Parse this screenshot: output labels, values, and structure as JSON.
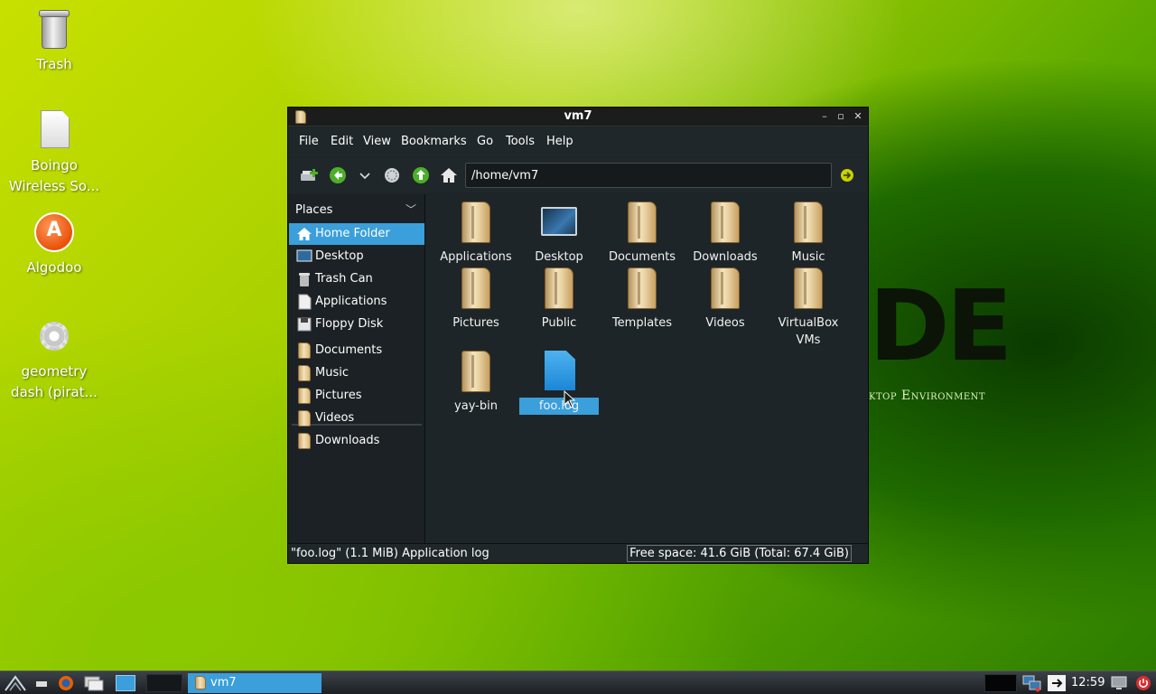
{
  "desktop": {
    "icons": [
      {
        "label": "Trash",
        "icon": "trash-icon"
      },
      {
        "label": "Boingo\nWireless So...",
        "icon": "document-icon"
      },
      {
        "label": "Algodoo",
        "icon": "algodoo-icon"
      },
      {
        "label": "geometry\ndash (pirat...",
        "icon": "gear-icon"
      }
    ],
    "wallpaper_logo": "DE",
    "wallpaper_subtitle": "ktop Environment"
  },
  "window": {
    "title": "vm7",
    "menu": [
      "File",
      "Edit",
      "View",
      "Bookmarks",
      "Go",
      "Tools",
      "Help"
    ],
    "location": "/home/vm7",
    "sidebar": {
      "header": "Places",
      "places": [
        {
          "label": "Home Folder",
          "icon": "home-icon",
          "selected": true
        },
        {
          "label": "Desktop",
          "icon": "desktop-icon"
        },
        {
          "label": "Trash Can",
          "icon": "trash-icon"
        },
        {
          "label": "Applications",
          "icon": "applications-icon"
        },
        {
          "label": "Floppy Disk",
          "icon": "floppy-icon"
        }
      ],
      "bookmarks": [
        {
          "label": "Documents",
          "icon": "folder-icon"
        },
        {
          "label": "Music",
          "icon": "folder-icon"
        },
        {
          "label": "Pictures",
          "icon": "folder-icon"
        },
        {
          "label": "Videos",
          "icon": "folder-icon"
        },
        {
          "label": "Downloads",
          "icon": "folder-icon"
        }
      ]
    },
    "files": [
      {
        "name": "Applications",
        "type": "folder"
      },
      {
        "name": "Desktop",
        "type": "desktop"
      },
      {
        "name": "Documents",
        "type": "folder"
      },
      {
        "name": "Downloads",
        "type": "folder"
      },
      {
        "name": "Music",
        "type": "folder"
      },
      {
        "name": "Pictures",
        "type": "folder"
      },
      {
        "name": "Public",
        "type": "folder"
      },
      {
        "name": "Templates",
        "type": "folder"
      },
      {
        "name": "Videos",
        "type": "folder"
      },
      {
        "name": "VirtualBox\nVMs",
        "type": "folder"
      },
      {
        "name": "yay-bin",
        "type": "folder"
      },
      {
        "name": "foo.log",
        "type": "log",
        "selected": true
      }
    ],
    "status_left": "\"foo.log\" (1.1 MiB) Application log",
    "status_right": "Free space: 41.6 GiB (Total: 67.4 GiB)"
  },
  "taskbar": {
    "task_label": "vm7",
    "clock": "12:59"
  },
  "colors": {
    "accent": "#3a9fda",
    "window_bg": "#1e2528",
    "toolbar_green": "#4caf2a"
  }
}
